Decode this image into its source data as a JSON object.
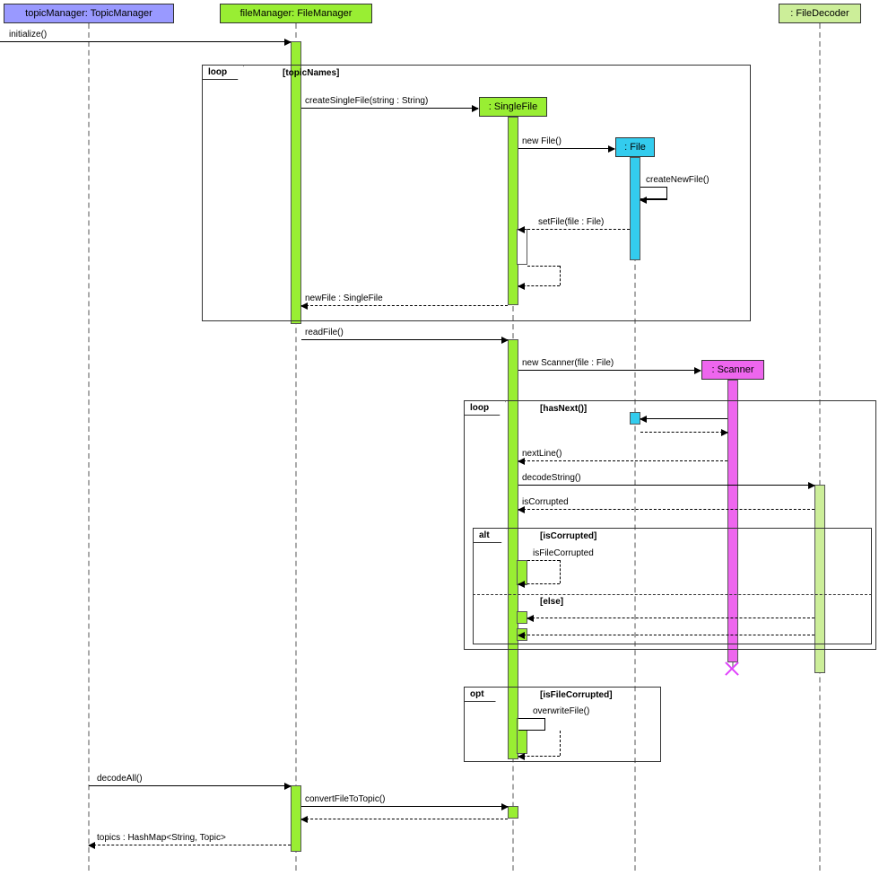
{
  "participants": {
    "topicManager": "topicManager: TopicManager",
    "fileManager": "fileManager: FileManager",
    "singleFile": ": SingleFile",
    "file": ": File",
    "scanner": ": Scanner",
    "fileDecoder": ": FileDecoder"
  },
  "messages": {
    "initialize": "initialize()",
    "createSingleFile": "createSingleFile(string : String)",
    "newFile": "new File()",
    "createNewFile": "createNewFile()",
    "setFile": "setFile(file : File)",
    "returnNewFile": "newFile : SingleFile",
    "readFile": "readFile()",
    "newScanner": "new Scanner(file : File)",
    "nextLine": "nextLine()",
    "decodeString": "decodeString()",
    "isCorrupted": "isCorrupted",
    "isFileCorrupted": "isFileCorrupted",
    "overwriteFile": "overwriteFile()",
    "decodeAll": "decodeAll()",
    "convertFileToTopic": "convertFileToTopic()",
    "returnTopics": "topics : HashMap<String, Topic>"
  },
  "frames": {
    "loop1": "loop",
    "loop1guard": "[topicNames]",
    "loop2": "loop",
    "loop2guard": "[hasNext()]",
    "alt": "alt",
    "altguard": "[isCorrupted]",
    "elseguard": "[else]",
    "opt": "opt",
    "optguard": "[isFileCorrupted]"
  },
  "colors": {
    "blue": "#9999ff",
    "green": "#99ee33",
    "cyan": "#33ccee",
    "magenta": "#ee66ee",
    "lightgreen": "#ccee99"
  }
}
